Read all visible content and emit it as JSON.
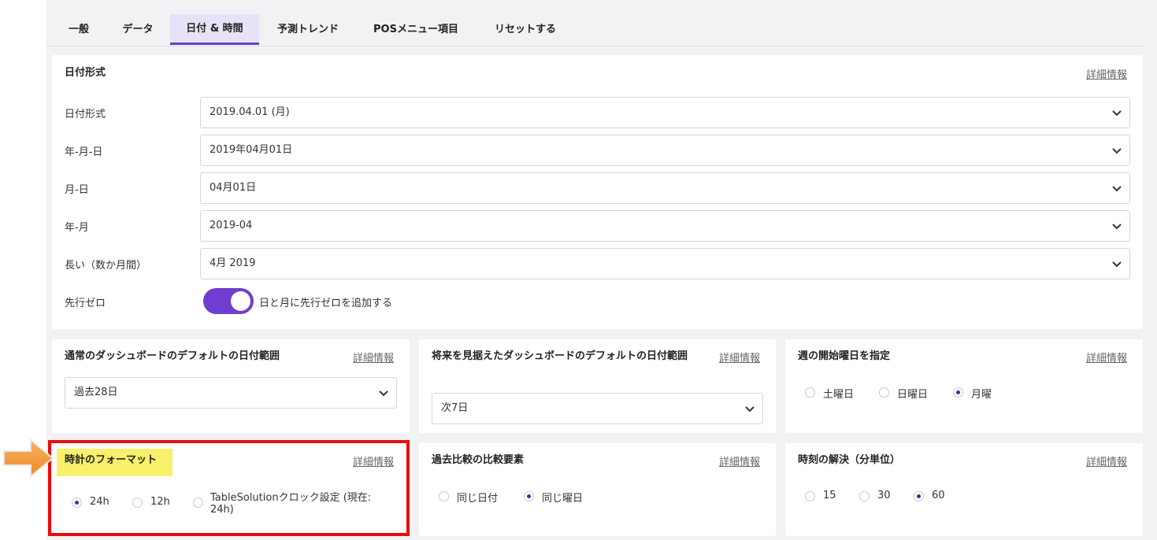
{
  "tabs": [
    {
      "label": "一般",
      "active": false
    },
    {
      "label": "データ",
      "active": false
    },
    {
      "label": "日付 & 時間",
      "active": true
    },
    {
      "label": "予測トレンド",
      "active": false
    },
    {
      "label": "POSメニュー項目",
      "active": false
    },
    {
      "label": "リセットする",
      "active": false
    }
  ],
  "date_format": {
    "title": "日付形式",
    "more": "詳細情報",
    "rows": [
      {
        "label": "日付形式",
        "value": "2019.04.01 (月)"
      },
      {
        "label": "年-月-日",
        "value": "2019年04月01日"
      },
      {
        "label": "月-日",
        "value": "04月01日"
      },
      {
        "label": "年-月",
        "value": "2019-04"
      },
      {
        "label": "長い（数か月間）",
        "value": "4月 2019"
      }
    ],
    "leading_zero": {
      "label": "先行ゼロ",
      "toggle_label": "日と月に先行ゼロを追加する",
      "enabled": true
    }
  },
  "default_range": {
    "title": "通常のダッシュボードのデフォルトの日付範囲",
    "more": "詳細情報",
    "value": "過去28日"
  },
  "future_range": {
    "title": "将来を見据えたダッシュボードのデフォルトの日付範囲",
    "more": "詳細情報",
    "value": "次7日"
  },
  "week_start": {
    "title": "週の開始曜日を指定",
    "more": "詳細情報",
    "options": [
      "土曜日",
      "日曜日",
      "月曜"
    ],
    "selected": "月曜"
  },
  "clock_format": {
    "title": "時計のフォーマット",
    "more": "詳細情報",
    "options": [
      "24h",
      "12h",
      "TableSolutionクロック設定 (現在:",
      "24h)"
    ],
    "selected": "24h"
  },
  "comparison": {
    "title": "過去比較の比較要素",
    "more": "詳細情報",
    "options": [
      "同じ日付",
      "同じ曜日"
    ],
    "selected": "同じ曜日"
  },
  "time_resolution": {
    "title": "時刻の解決（分単位）",
    "more": "詳細情報",
    "options": [
      "15",
      "30",
      "60"
    ],
    "selected": "60"
  },
  "colors": {
    "accent": "#6f3ed1",
    "tab_active_bg": "#e7e2f7",
    "annotation_red": "#e80d0d",
    "annotation_yellow": "#f8f06a",
    "arrow_orange": "#f29a3a"
  }
}
